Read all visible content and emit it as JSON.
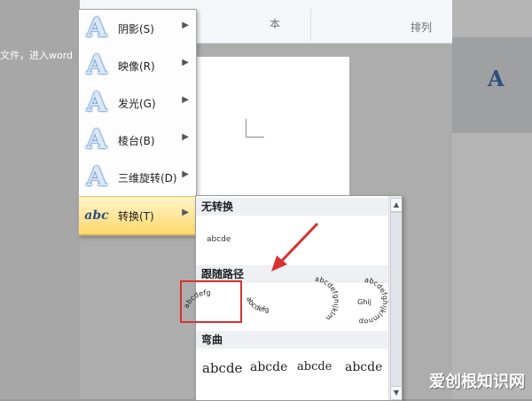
{
  "background": {
    "left_text": "文件，进入word",
    "ribbon_tab": "本",
    "ribbon_group": "排列"
  },
  "menu": {
    "items": [
      {
        "label": "阴影(S)",
        "icon": "shadow-a-icon"
      },
      {
        "label": "映像(R)",
        "icon": "reflection-a-icon"
      },
      {
        "label": "发光(G)",
        "icon": "glow-a-icon"
      },
      {
        "label": "棱台(B)",
        "icon": "bevel-a-icon"
      },
      {
        "label": "三维旋转(D)",
        "icon": "rotation-3d-a-icon"
      },
      {
        "label": "转换(T)",
        "icon": "transform-abc-icon",
        "active": true
      }
    ],
    "arrow": "▶"
  },
  "submenu": {
    "sections": [
      {
        "title": "无转换"
      },
      {
        "title": "跟随路径"
      },
      {
        "title": "弯曲"
      }
    ],
    "plain_sample": "abcde",
    "path_samples": [
      "abcdefg",
      "abcdefg",
      "abcdefghijklm",
      "abcdefghijklmnop"
    ],
    "path_center_text": "Ghij",
    "warp_samples": [
      "abcde",
      "abcde",
      "abcde",
      "abcde"
    ],
    "scroll_up": "▲",
    "scroll_down": "▼"
  },
  "watermark": "爱创根知识网",
  "colors": {
    "highlight": "#ffd86b",
    "annotation": "#d7322f"
  }
}
